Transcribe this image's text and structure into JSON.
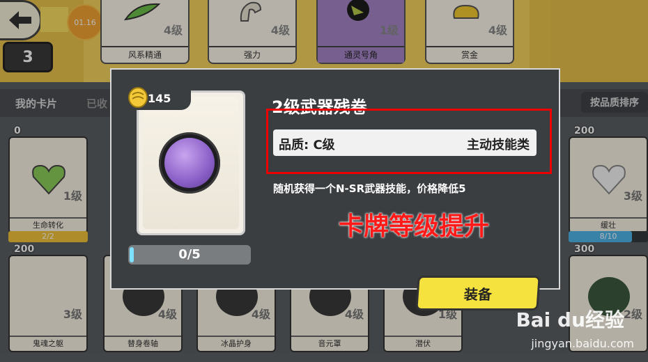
{
  "top_bar": {
    "timer": "01.16",
    "player_level": "3",
    "cards": [
      {
        "name": "风系精通",
        "level": "4级"
      },
      {
        "name": "强力",
        "level": "4级"
      },
      {
        "name": "通灵号角",
        "level": "1级"
      },
      {
        "name": "赏金",
        "level": "4级"
      }
    ]
  },
  "list": {
    "tabs": [
      "我的卡片",
      "已收"
    ],
    "sort_label": "按品质排序",
    "row1": [
      {
        "cost": "0",
        "name": "生命转化",
        "level": "1级",
        "progress": "2/2",
        "fill": 1.0
      },
      {
        "cost": "200",
        "name": "缓壮",
        "level": "3级",
        "progress": "8/10",
        "fill": 0.8
      }
    ],
    "row2": [
      {
        "cost": "200",
        "name": "鬼魂之躯",
        "level": "3级"
      },
      {
        "cost": "",
        "name": "替身卷轴",
        "level": "4级"
      },
      {
        "cost": "",
        "name": "冰晶护身",
        "level": "4级"
      },
      {
        "cost": "",
        "name": "音元罩",
        "level": "4级"
      },
      {
        "cost": "",
        "name": "潜伏",
        "level": "1级"
      },
      {
        "cost": "300",
        "name": "",
        "level": "2级"
      }
    ]
  },
  "modal": {
    "cost": "145",
    "title": "2级武器残卷",
    "quality_label": "品质: C级",
    "quality_type": "主动技能类",
    "description": "随机获得一个N-SR武器技能，价格降低5",
    "quantity": "0/5",
    "equip_label": "装备",
    "annotation": "卡牌等级提升"
  },
  "watermark": {
    "text": "Bai du经验",
    "url": "jingyan.baidu.com"
  },
  "colors": {
    "accent_yellow": "#f6e23e",
    "highlight_red": "#e00000",
    "quality_bg": "#f1f1f1",
    "modal_bg": "#3b3e41"
  }
}
